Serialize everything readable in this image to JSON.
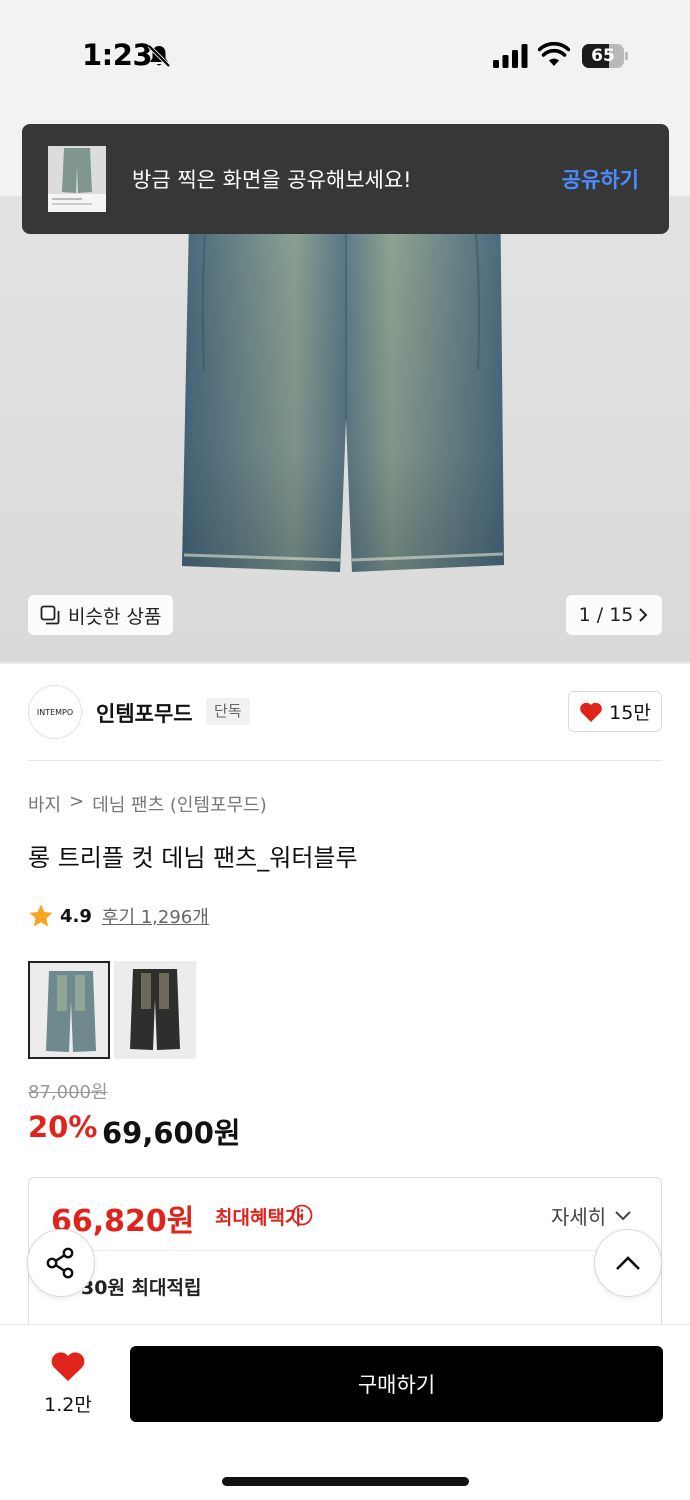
{
  "status_bar": {
    "time": "1:23",
    "battery": "65",
    "battery_level": 0.65
  },
  "toast": {
    "message": "방금 찍은 화면을 공유해보세요!",
    "action": "공유하기"
  },
  "gallery": {
    "similar_label": "비슷한 상품",
    "page_indicator": "1 / 15"
  },
  "brand": {
    "logo_text": "INTEMPO",
    "name": "인템포무드",
    "badge": "단독",
    "like_count": "15만"
  },
  "breadcrumb": {
    "category": "바지",
    "subcategory": "데님 팬츠 (인템포무드)"
  },
  "product": {
    "title": "롱 트리플 컷 데님 팬츠_워터블루",
    "rating": "4.9",
    "review_text": "후기 1,296개",
    "color_options": [
      {
        "name": "워터블루",
        "selected": true
      },
      {
        "name": "블랙",
        "selected": false
      }
    ]
  },
  "price": {
    "original": "87,000원",
    "discount": "20%",
    "sale": "69,600원"
  },
  "benefit": {
    "max_price": "66,820원",
    "max_label": "최대혜택가",
    "detail_label": "자세히",
    "points_text": "30원 최대적립"
  },
  "bottom_bar": {
    "wish_count": "1.2만",
    "buy_label": "구매하기"
  },
  "colors": {
    "accent_red": "#e0241c",
    "toast_link": "#4d8cff",
    "buy_button": "#000000"
  }
}
